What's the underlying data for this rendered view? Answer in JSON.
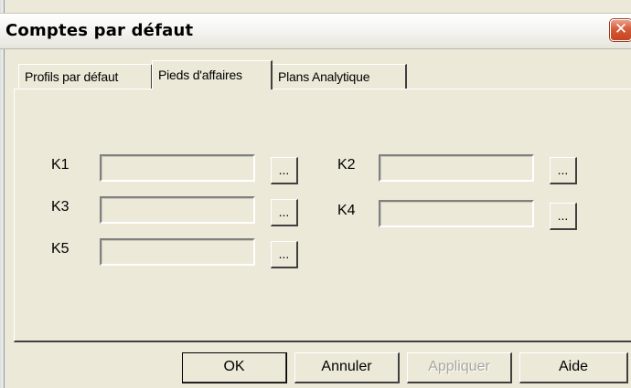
{
  "window": {
    "title": "Comptes par défaut",
    "close_glyph": "✕"
  },
  "tabs": [
    {
      "label": "Profils par défaut",
      "active": false
    },
    {
      "label": "Pieds d'affaires",
      "active": true
    },
    {
      "label": "Plans Analytique",
      "active": false
    }
  ],
  "fields": [
    {
      "label": "K1",
      "value": ""
    },
    {
      "label": "K2",
      "value": ""
    },
    {
      "label": "K3",
      "value": ""
    },
    {
      "label": "K4",
      "value": ""
    },
    {
      "label": "K5",
      "value": ""
    }
  ],
  "browse_button_label": "...",
  "buttons": {
    "ok": "OK",
    "cancel": "Annuler",
    "apply": "Appliquer",
    "help": "Aide"
  },
  "colors": {
    "background": "#ece9d8",
    "close_button": "#d65a38",
    "disabled_text": "#a7a6a0"
  }
}
